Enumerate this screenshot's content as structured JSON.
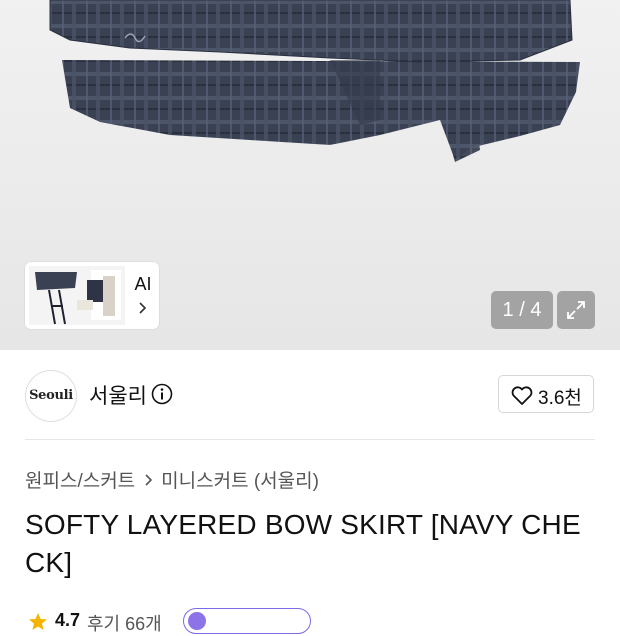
{
  "gallery": {
    "ai_label": "AI",
    "page_counter": "1 / 4",
    "current_page": 1,
    "total_pages": 4
  },
  "brand": {
    "logo_text": "Seouli",
    "name": "서울리",
    "like_count": "3.6천"
  },
  "breadcrumb": {
    "category": "원피스/스커트",
    "subcategory": "미니스커트 (서울리)"
  },
  "product": {
    "title": "SOFTY LAYERED BOW SKIRT [NAVY CHECK]"
  },
  "rating": {
    "value": "4.7",
    "reviews": "후기 66개"
  },
  "colors": {
    "navy_check": "#3b4254",
    "accent_purple": "#7b6ae6"
  }
}
